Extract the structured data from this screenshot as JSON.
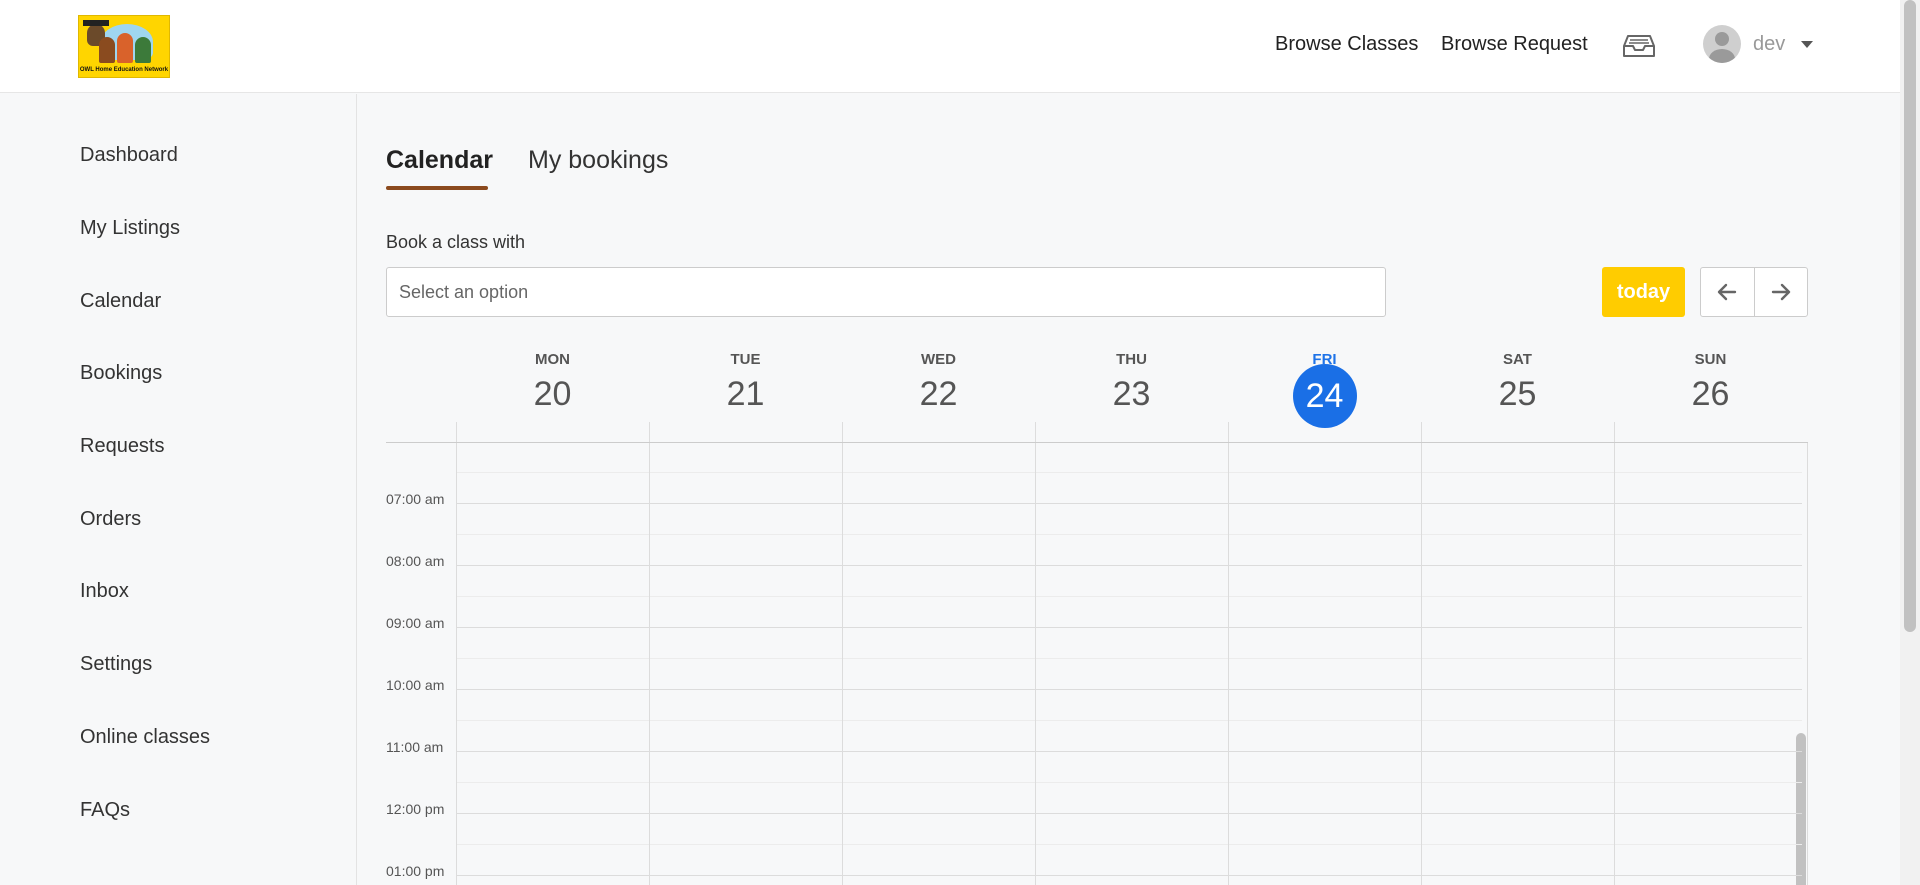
{
  "header": {
    "logo_text": "OWL Home Education Network",
    "nav": {
      "browse_classes": "Browse Classes",
      "browse_request": "Browse Request"
    },
    "user": {
      "name": "dev"
    }
  },
  "sidebar": {
    "items": [
      {
        "label": "Dashboard"
      },
      {
        "label": "My Listings"
      },
      {
        "label": "Calendar"
      },
      {
        "label": "Bookings"
      },
      {
        "label": "Requests"
      },
      {
        "label": "Orders"
      },
      {
        "label": "Inbox"
      },
      {
        "label": "Settings"
      },
      {
        "label": "Online classes"
      },
      {
        "label": "FAQs"
      }
    ]
  },
  "main": {
    "tabs": [
      {
        "label": "Calendar"
      },
      {
        "label": "My bookings"
      }
    ],
    "book_label": "Book a class with",
    "select_placeholder": "Select an option",
    "today_label": "today"
  },
  "calendar": {
    "days": [
      {
        "name": "MON",
        "num": "20"
      },
      {
        "name": "TUE",
        "num": "21"
      },
      {
        "name": "WED",
        "num": "22"
      },
      {
        "name": "THU",
        "num": "23"
      },
      {
        "name": "FRI",
        "num": "24"
      },
      {
        "name": "SAT",
        "num": "25"
      },
      {
        "name": "SUN",
        "num": "26"
      }
    ],
    "current_day": "FRI",
    "times": [
      "07:00 am",
      "08:00 am",
      "09:00 am",
      "10:00 am",
      "11:00 am",
      "12:00 pm",
      "01:00 pm"
    ]
  },
  "colors": {
    "accent_today": "#ffcc00",
    "current_day_blue": "#1a6fe6",
    "tab_underline": "#8b4a1e"
  }
}
